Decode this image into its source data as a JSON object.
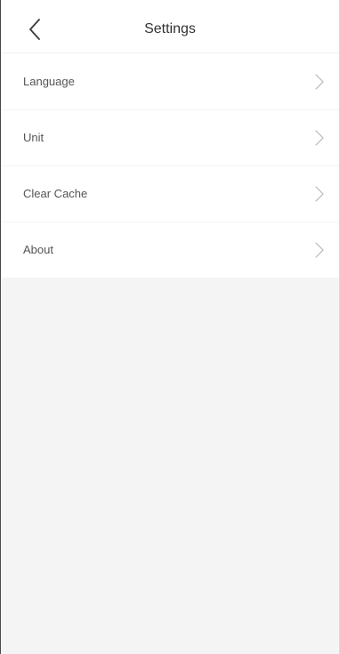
{
  "header": {
    "title": "Settings",
    "back_icon": "chevron-left-icon"
  },
  "settings": {
    "items": [
      {
        "label": "Language",
        "icon": "chevron-right-icon"
      },
      {
        "label": "Unit",
        "icon": "chevron-right-icon"
      },
      {
        "label": "Clear Cache",
        "icon": "chevron-right-icon"
      },
      {
        "label": "About",
        "icon": "chevron-right-icon"
      }
    ]
  },
  "colors": {
    "background": "#f4f4f4",
    "surface": "#ffffff",
    "text": "#555555",
    "chevron": "#b5b5b5"
  }
}
